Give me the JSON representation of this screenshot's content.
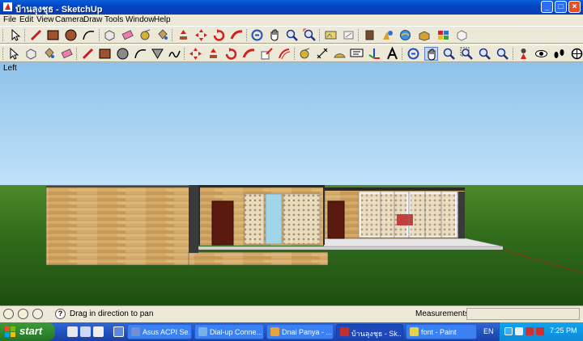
{
  "window": {
    "title": "บ้านลุงชุธ - SketchUp",
    "buttons": {
      "minimize": "_",
      "maximize": "□",
      "close": "×"
    }
  },
  "menu": [
    "File",
    "Edit",
    "View",
    "Camera",
    "Draw",
    "Tools",
    "Window",
    "Help"
  ],
  "viewport": {
    "view_label": "Left"
  },
  "statusbar": {
    "hint": "Drag in direction to pan",
    "help_icon": "?",
    "measurements_label": "Measurements",
    "measurements_value": ""
  },
  "taskbar": {
    "start_label": "start",
    "tasks": [
      {
        "label": "Asus ACPI Se...",
        "color": "#6f8fd8"
      },
      {
        "label": "Dial-up Conne...",
        "color": "#7ab0e8"
      },
      {
        "label": "Dnai Panya - ...",
        "color": "#e8a23c"
      },
      {
        "label": "บ้านลุงชุธ - Sk...",
        "color": "#c03030",
        "active": true
      },
      {
        "label": "font - Paint",
        "color": "#e8d050"
      }
    ],
    "language": "EN",
    "clock": "7:25 PM"
  },
  "colors": {
    "sky_top": "#8ec3ea",
    "sky_bottom": "#bfe2f8",
    "ground": "#2f6b1a",
    "wood": "#d4ab6a",
    "door": "#5a1a0e"
  }
}
